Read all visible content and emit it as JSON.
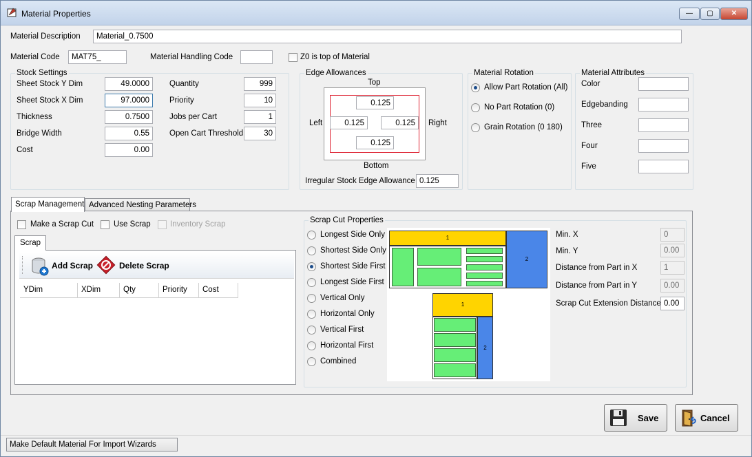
{
  "window": {
    "title": "Material Properties",
    "minimize_glyph": "—",
    "maximize_glyph": "▢",
    "close_glyph": "✕"
  },
  "header": {
    "description_label": "Material Description",
    "description_value": "Material_0.7500",
    "code_label": "Material Code",
    "code_value": "MAT75_",
    "handling_label": "Material Handling Code",
    "handling_value": "",
    "z0_label": "Z0 is top of Material"
  },
  "stock": {
    "title": "Stock Settings",
    "sheet_y_label": "Sheet Stock Y Dim",
    "sheet_y_value": "49.0000",
    "sheet_x_label": "Sheet Stock X Dim",
    "sheet_x_value": "97.0000",
    "thickness_label": "Thickness",
    "thickness_value": "0.7500",
    "bridge_label": "Bridge Width",
    "bridge_value": "0.55",
    "cost_label": "Cost",
    "cost_value": "0.00",
    "quantity_label": "Quantity",
    "quantity_value": "999",
    "priority_label": "Priority",
    "priority_value": "10",
    "jobs_label": "Jobs per Cart",
    "jobs_value": "1",
    "open_cart_label": "Open Cart Threshold",
    "open_cart_value": "30"
  },
  "edge": {
    "title": "Edge Allowances",
    "top_label": "Top",
    "bottom_label": "Bottom",
    "left_label": "Left",
    "right_label": "Right",
    "top_value": "0.125",
    "left_value": "0.125",
    "right_value": "0.125",
    "bottom_value": "0.125",
    "irregular_label": "Irregular Stock Edge Allowance",
    "irregular_value": "0.125"
  },
  "rotation": {
    "title": "Material Rotation",
    "options": [
      "Allow Part Rotation (All)",
      "No Part Rotation (0)",
      "Grain Rotation (0 180)"
    ],
    "selected": 0
  },
  "attributes": {
    "title": "Material Attributes",
    "labels": [
      "Color",
      "Edgebanding",
      "Three",
      "Four",
      "Five"
    ],
    "values": [
      "",
      "",
      "",
      "",
      ""
    ]
  },
  "tabs": [
    "Scrap Management",
    "Advanced Nesting Parameters"
  ],
  "scrap": {
    "make_cut_label": "Make a Scrap Cut",
    "use_scrap_label": "Use Scrap",
    "inventory_label": "Inventory Scrap",
    "inner_tab": "Scrap",
    "add_label": "Add Scrap",
    "delete_label": "Delete Scrap",
    "columns": [
      "YDim",
      "XDim",
      "Qty",
      "Priority",
      "Cost"
    ]
  },
  "cut_props": {
    "title": "Scrap Cut Properties",
    "options": [
      "Longest Side Only",
      "Shortest Side Only",
      "Shortest Side First",
      "Longest Side First",
      "Vertical Only",
      "Horizontal Only",
      "Vertical First",
      "Horizontal First",
      "Combined"
    ],
    "selected": 2,
    "diagram_label_1": "1",
    "diagram_label_2": "2",
    "min_x_label": "Min. X",
    "min_x_value": "0",
    "min_y_label": "Min. Y",
    "min_y_value": "0.00",
    "dist_x_label": "Distance from Part in X",
    "dist_x_value": "1",
    "dist_y_label": "Distance from Part in Y",
    "dist_y_value": "0.00",
    "ext_label": "Scrap Cut Extension Distance",
    "ext_value": "0.00"
  },
  "buttons": {
    "save": "Save",
    "cancel": "Cancel"
  },
  "status": {
    "default_button": "Make Default Material For Import Wizards"
  },
  "colors": {
    "scrap_yellow": "#ffd400",
    "scrap_blue": "#4a86e8",
    "part_green": "#66ee77"
  }
}
